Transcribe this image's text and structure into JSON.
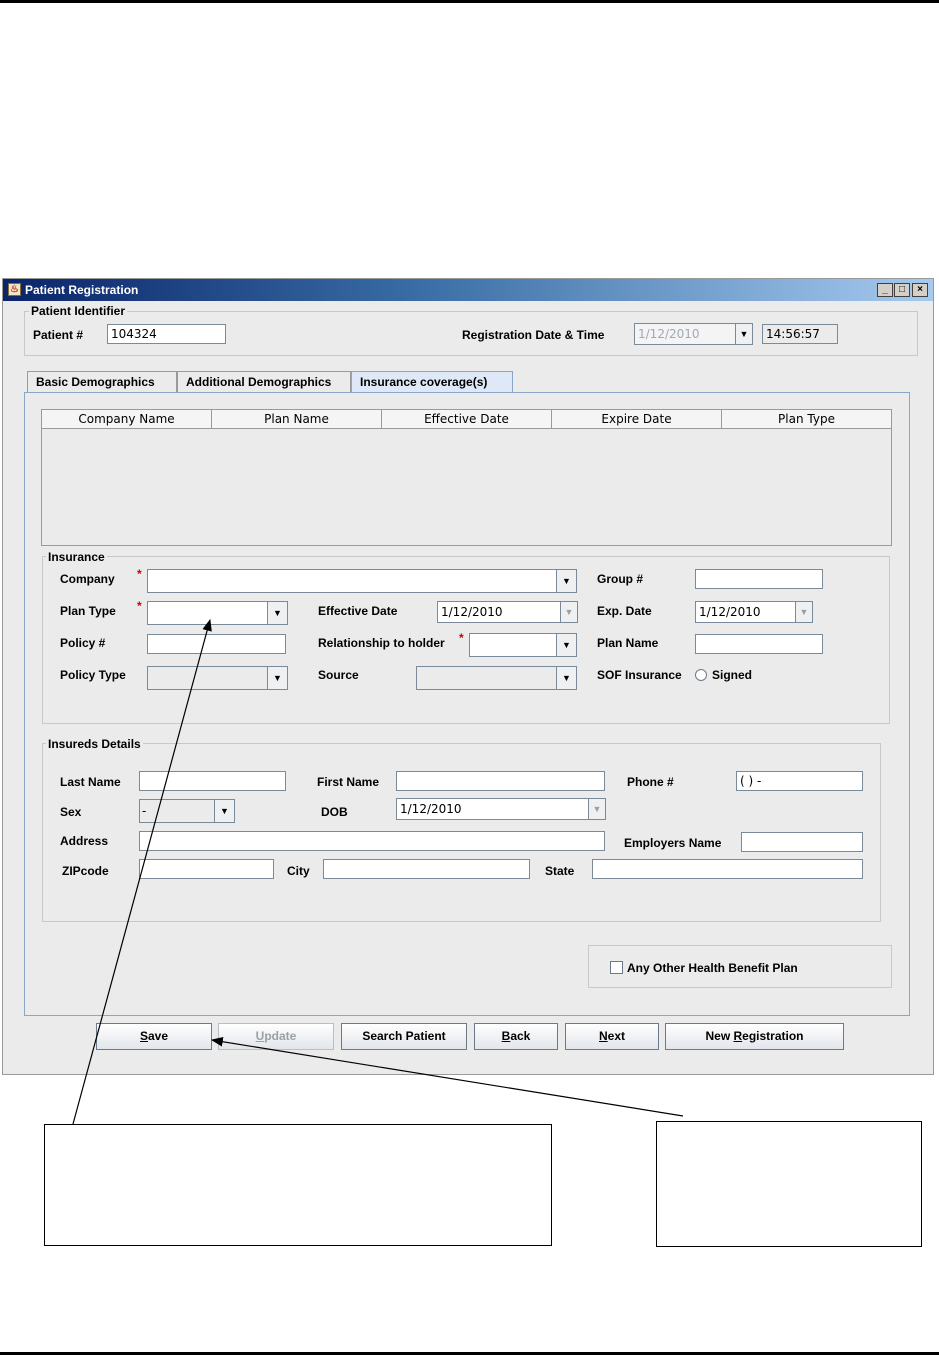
{
  "window": {
    "title": "Patient Registration"
  },
  "patient_identifier": {
    "group_title": "Patient Identifier",
    "patient_no_label": "Patient #",
    "patient_no_value": "104324",
    "reg_label": "Registration Date & Time",
    "reg_date": "1/12/2010",
    "reg_time": "14:56:57"
  },
  "tabs": [
    {
      "label": "Basic Demographics"
    },
    {
      "label": "Additional Demographics"
    },
    {
      "label": "Insurance coverage(s)"
    }
  ],
  "table": {
    "columns": [
      "Company Name",
      "Plan Name",
      "Effective Date",
      "Expire Date",
      "Plan Type"
    ]
  },
  "insurance": {
    "group_title": "Insurance",
    "company_label": "Company",
    "group_no_label": "Group #",
    "plan_type_label": "Plan Type",
    "effective_date_label": "Effective Date",
    "effective_date_value": "1/12/2010",
    "exp_date_label": "Exp. Date",
    "exp_date_value": "1/12/2010",
    "policy_no_label": "Policy #",
    "relationship_label": "Relationship to holder",
    "plan_name_label": "Plan Name",
    "policy_type_label": "Policy Type",
    "source_label": "Source",
    "sof_label": "SOF Insurance",
    "signed_label": "Signed",
    "required_marker": "*"
  },
  "insureds": {
    "group_title": "Insureds Details",
    "last_name_label": "Last Name",
    "first_name_label": "First Name",
    "phone_label": "Phone #",
    "phone_value": "(  )  -",
    "sex_label": "Sex",
    "sex_value": "-",
    "dob_label": "DOB",
    "dob_value": "1/12/2010",
    "address_label": "Address",
    "employers_label": "Employers Name",
    "zip_label": "ZIPcode",
    "city_label": "City",
    "state_label": "State"
  },
  "other_plan": {
    "label": "Any Other Health Benefit Plan"
  },
  "buttons": {
    "save": {
      "mnemonic": "S",
      "rest": "ave"
    },
    "update": {
      "mnemonic": "U",
      "rest": "pdate"
    },
    "search": {
      "label": "Search Patient"
    },
    "back": {
      "mnemonic": "B",
      "rest": "ack"
    },
    "next": {
      "mnemonic": "N",
      "rest": "ext"
    },
    "new_registration": {
      "pre": "New ",
      "mnemonic": "R",
      "rest": "egistration"
    }
  },
  "icons": {
    "app": "java-cup-icon",
    "minimize": "minimize-icon",
    "maximize": "maximize-icon",
    "close": "close-icon",
    "dropdown": "chevron-down-icon"
  }
}
